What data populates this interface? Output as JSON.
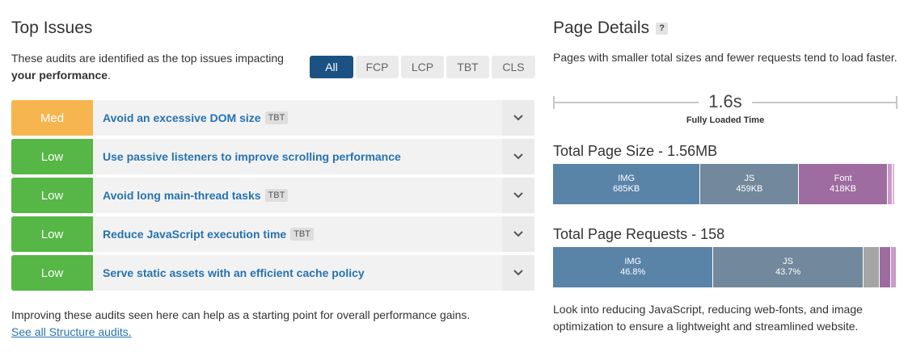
{
  "left": {
    "title": "Top Issues",
    "intro_prefix": "These audits are identified as the top issues impacting",
    "intro_bold": "your performance",
    "intro_suffix": ".",
    "filters": [
      {
        "label": "All",
        "active": true
      },
      {
        "label": "FCP",
        "active": false
      },
      {
        "label": "LCP",
        "active": false
      },
      {
        "label": "TBT",
        "active": false
      },
      {
        "label": "CLS",
        "active": false
      }
    ],
    "issues": [
      {
        "severity": "Med",
        "level": "med",
        "title": "Avoid an excessive DOM size",
        "tag": "TBT"
      },
      {
        "severity": "Low",
        "level": "low",
        "title": "Use passive listeners to improve scrolling performance",
        "tag": ""
      },
      {
        "severity": "Low",
        "level": "low",
        "title": "Avoid long main-thread tasks",
        "tag": "TBT"
      },
      {
        "severity": "Low",
        "level": "low",
        "title": "Reduce JavaScript execution time",
        "tag": "TBT"
      },
      {
        "severity": "Low",
        "level": "low",
        "title": "Serve static assets with an efficient cache policy",
        "tag": ""
      }
    ],
    "footnote": "Improving these audits seen here can help as a starting point for overall performance gains.",
    "footnote_link": "See all Structure audits."
  },
  "right": {
    "title": "Page Details",
    "help_icon": "?",
    "subtitle": "Pages with smaller total sizes and fewer requests tend to load faster.",
    "fully_loaded_value": "1.6s",
    "fully_loaded_label": "Fully Loaded Time",
    "size_title": "Total Page Size - 1.56MB",
    "size_segments": [
      {
        "label": "IMG",
        "value": "685KB",
        "share": 0.43,
        "color": "#5a83a8"
      },
      {
        "label": "JS",
        "value": "459KB",
        "share": 0.288,
        "color": "#72889c"
      },
      {
        "label": "Font",
        "value": "418KB",
        "share": 0.258,
        "color": "#9e6ca0"
      },
      {
        "label": "",
        "value": "",
        "share": 0.014,
        "color": "#c99bc7"
      },
      {
        "label": "",
        "value": "",
        "share": 0.005,
        "color": "#d6b7d4"
      }
    ],
    "requests_title": "Total Page Requests - 158",
    "requests_segments": [
      {
        "label": "IMG",
        "value": "46.8%",
        "share": 0.468,
        "color": "#5a83a8"
      },
      {
        "label": "JS",
        "value": "43.7%",
        "share": 0.437,
        "color": "#72889c"
      },
      {
        "label": "",
        "value": "",
        "share": 0.048,
        "color": "#a5a5a5"
      },
      {
        "label": "",
        "value": "",
        "share": 0.032,
        "color": "#9e6ca0"
      },
      {
        "label": "",
        "value": "",
        "share": 0.015,
        "color": "#c99bc7"
      }
    ],
    "bottom_text": "Look into reducing JavaScript, reducing web-fonts, and image optimization to ensure a lightweight and streamlined website."
  }
}
